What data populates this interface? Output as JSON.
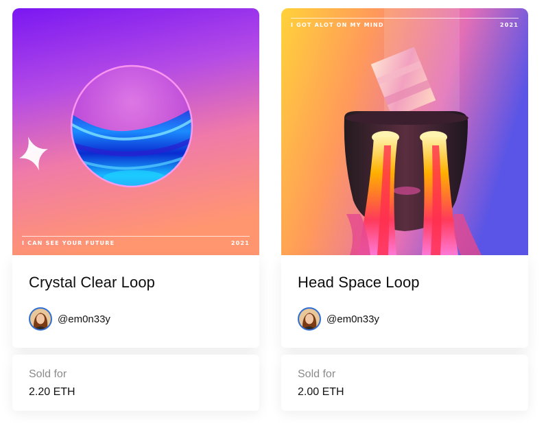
{
  "cards": [
    {
      "art_caption_left": "I CAN SEE YOUR FUTURE",
      "art_caption_right": "2021",
      "title": "Crystal Clear Loop",
      "creator_handle": "@em0n33y",
      "sale_label": "Sold for",
      "sale_value": "2.20 ETH"
    },
    {
      "art_caption_left": "I GOT ALOT ON MY MIND",
      "art_caption_right": "2021",
      "title": "Head Space Loop",
      "creator_handle": "@em0n33y",
      "sale_label": "Sold for",
      "sale_value": "2.00 ETH"
    }
  ],
  "colors": {
    "art1_top": "#7a17f2",
    "art1_bottom": "#ff8a6a",
    "art2_left": "#ffd23a",
    "art2_right": "#5a55e6"
  },
  "icons": [
    "sparkle-icon",
    "avatar"
  ]
}
